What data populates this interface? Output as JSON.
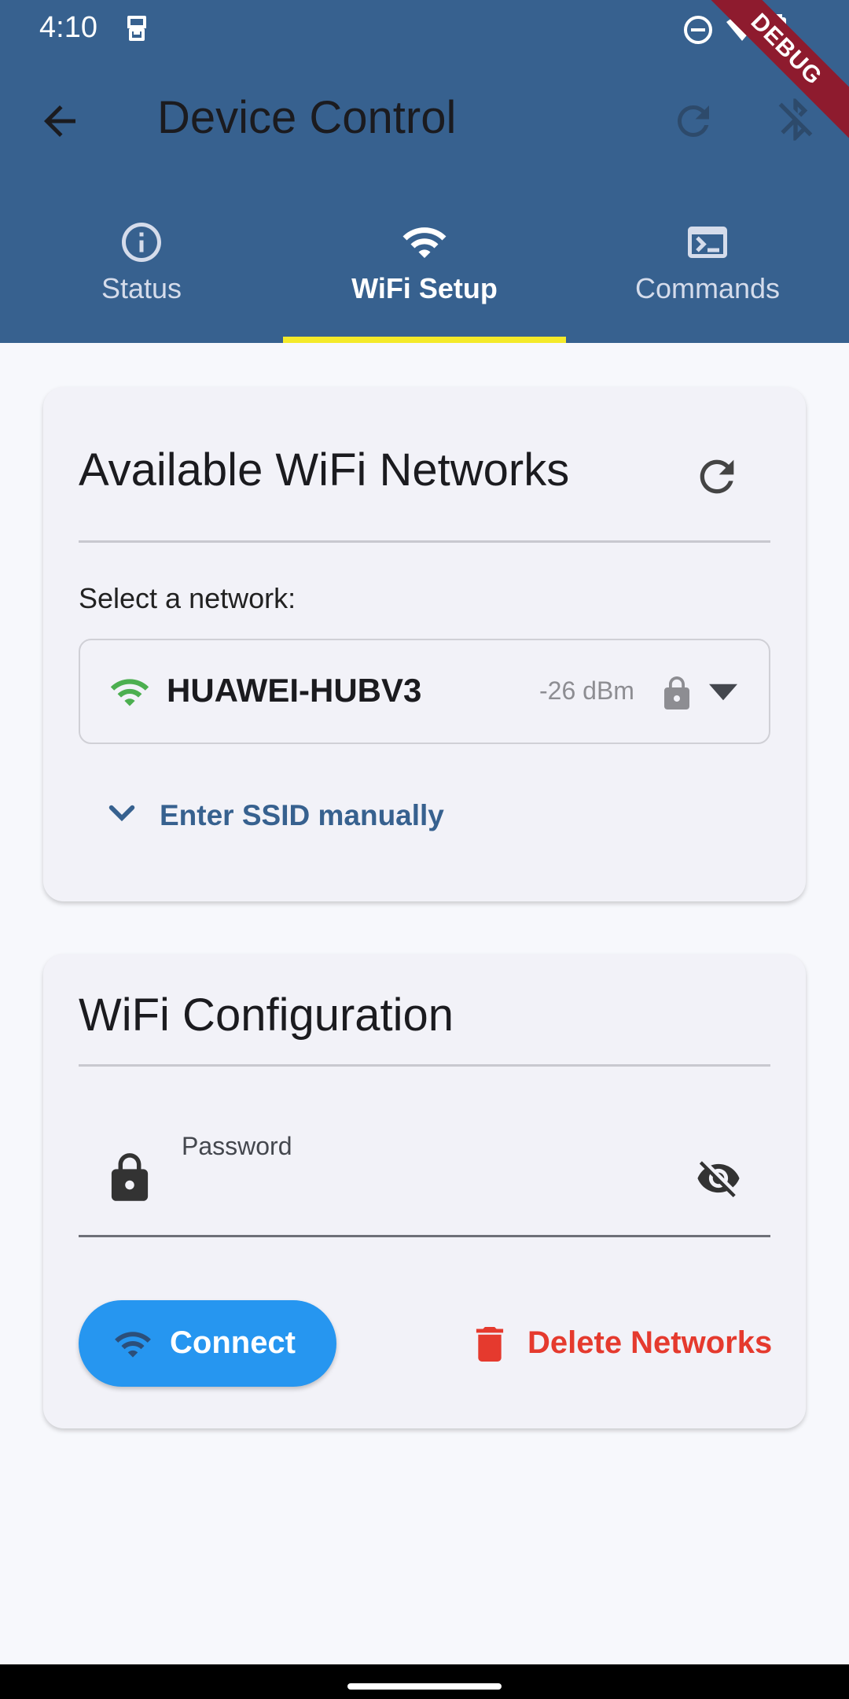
{
  "status_bar": {
    "time": "4:10"
  },
  "debug_banner": "DEBUG",
  "app_bar": {
    "title": "Device Control"
  },
  "tabs": [
    {
      "label": "Status",
      "icon": "info-icon"
    },
    {
      "label": "WiFi Setup",
      "icon": "wifi-icon",
      "selected": true
    },
    {
      "label": "Commands",
      "icon": "terminal-icon"
    }
  ],
  "networks_card": {
    "title": "Available WiFi Networks",
    "select_label": "Select a network:",
    "selected_network": {
      "ssid": "HUAWEI-HUBV3",
      "rssi": "-26 dBm",
      "secured": true
    },
    "manual_ssid_label": "Enter SSID manually"
  },
  "config_card": {
    "title": "WiFi Configuration",
    "password_label": "Password",
    "password_value": "",
    "connect_label": "Connect",
    "delete_label": "Delete Networks"
  },
  "colors": {
    "app_bar": "#37618f",
    "tab_indicator": "#f4ea2a",
    "connect_button": "#2696f0",
    "delete_text": "#e53a2e",
    "wifi_signal": "#4caf50"
  }
}
